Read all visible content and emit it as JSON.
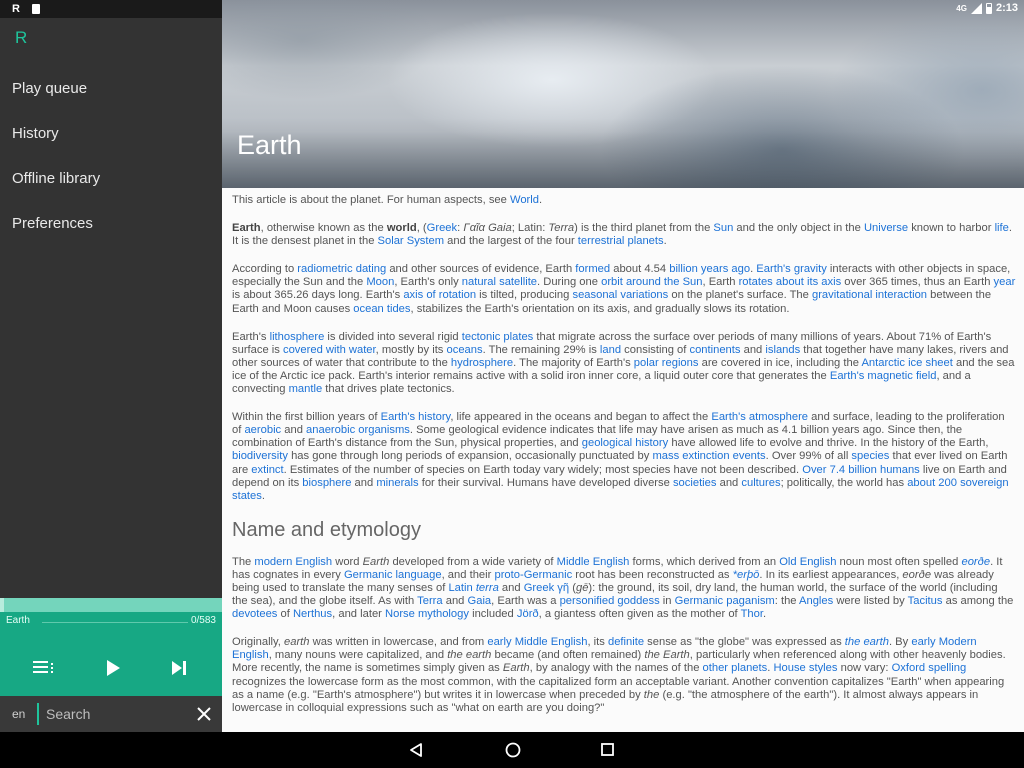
{
  "status_bar": {
    "left_letter": "R",
    "network": "4G",
    "time": "2:13"
  },
  "app": {
    "logo": "R"
  },
  "sidebar": {
    "items": [
      {
        "label": "Play queue"
      },
      {
        "label": "History"
      },
      {
        "label": "Offline library"
      },
      {
        "label": "Preferences"
      }
    ]
  },
  "player": {
    "track_title": "Earth",
    "track_count": "0/583",
    "progress_fraction": 0.02
  },
  "search": {
    "lang": "en",
    "placeholder": "Search",
    "value": ""
  },
  "article": {
    "title": "Earth",
    "hatnote": [
      "This article is about the planet. For human aspects, see ",
      {
        "a": "World"
      },
      "."
    ],
    "paragraphs_1": [
      [
        {
          "b": "Earth"
        },
        ", otherwise known as the ",
        {
          "b": "world"
        },
        ", (",
        {
          "a": "Greek"
        },
        ": ",
        {
          "i": "Γαῖα Gaia"
        },
        "; Latin: ",
        {
          "i": "Terra"
        },
        ") is the third planet from the ",
        {
          "a": "Sun"
        },
        " and the only object in the ",
        {
          "a": "Universe"
        },
        " known to harbor ",
        {
          "a": "life"
        },
        ". It is the densest planet in the ",
        {
          "a": "Solar System"
        },
        " and the largest of the four ",
        {
          "a": "terrestrial planets"
        },
        "."
      ],
      [
        "According to ",
        {
          "a": "radiometric dating"
        },
        " and other sources of evidence, Earth ",
        {
          "a": "formed"
        },
        " about 4.54 ",
        {
          "a": "billion years ago"
        },
        ". ",
        {
          "a": "Earth's gravity"
        },
        " interacts with other objects in space, especially the Sun and the ",
        {
          "a": "Moon"
        },
        ", Earth's only ",
        {
          "a": "natural satellite"
        },
        ". During one ",
        {
          "a": "orbit around the Sun"
        },
        ", Earth ",
        {
          "a": "rotates about its axis"
        },
        " over 365 times, thus an Earth ",
        {
          "a": "year"
        },
        " is about 365.26 days long. Earth's ",
        {
          "a": "axis of rotation"
        },
        " is tilted, producing ",
        {
          "a": "seasonal variations"
        },
        " on the planet's surface. The ",
        {
          "a": "gravitational interaction"
        },
        " between the Earth and Moon causes ",
        {
          "a": "ocean tides"
        },
        ", stabilizes the Earth's orientation on its axis, and gradually slows its rotation."
      ],
      [
        "Earth's ",
        {
          "a": "lithosphere"
        },
        " is divided into several rigid ",
        {
          "a": "tectonic plates"
        },
        " that migrate across the surface over periods of many millions of years. About 71% of Earth's surface is ",
        {
          "a": "covered with water"
        },
        ", mostly by its ",
        {
          "a": "oceans"
        },
        ". The remaining 29% is ",
        {
          "a": "land"
        },
        " consisting of ",
        {
          "a": "continents"
        },
        " and ",
        {
          "a": "islands"
        },
        " that together have many lakes, rivers and other sources of water that contribute to the ",
        {
          "a": "hydrosphere"
        },
        ". The majority of Earth's ",
        {
          "a": "polar regions"
        },
        " are covered in ice, including the ",
        {
          "a": "Antarctic ice sheet"
        },
        " and the sea ice of the Arctic ice pack. Earth's interior remains active with a solid iron inner core, a liquid outer core that generates the ",
        {
          "a": "Earth's magnetic field"
        },
        ", and a convecting ",
        {
          "a": "mantle"
        },
        " that drives plate tectonics."
      ],
      [
        "Within the first billion years of ",
        {
          "a": "Earth's history"
        },
        ", life appeared in the oceans and began to affect the ",
        {
          "a": "Earth's atmosphere"
        },
        " and surface, leading to the proliferation of ",
        {
          "a": "aerobic"
        },
        " and ",
        {
          "a": "anaerobic organisms"
        },
        ". Some geological evidence indicates that life may have arisen as much as 4.1 billion years ago. Since then, the combination of Earth's distance from the Sun, physical properties, and ",
        {
          "a": "geological history"
        },
        " have allowed life to evolve and thrive. In the history of the Earth, ",
        {
          "a": "biodiversity"
        },
        " has gone through long periods of expansion, occasionally punctuated by ",
        {
          "a": "mass extinction events"
        },
        ". Over 99% of all ",
        {
          "a": "species"
        },
        " that ever lived on Earth are ",
        {
          "a": "extinct"
        },
        ". Estimates of the number of species on Earth today vary widely; most species have not been described. ",
        {
          "a": "Over 7.4 billion humans"
        },
        " live on Earth and depend on its ",
        {
          "a": "biosphere"
        },
        " and ",
        {
          "a": "minerals"
        },
        " for their survival. Humans have developed diverse ",
        {
          "a": "societies"
        },
        " and ",
        {
          "a": "cultures"
        },
        "; politically, the world has ",
        {
          "a": "about 200 sovereign states"
        },
        "."
      ]
    ],
    "section_heading": "Name and etymology",
    "paragraphs_2": [
      [
        "The ",
        {
          "a": "modern English"
        },
        " word ",
        {
          "i": "Earth"
        },
        " developed from a wide variety of ",
        {
          "a": "Middle English"
        },
        " forms, which derived from an ",
        {
          "a": "Old English"
        },
        " noun most often spelled ",
        {
          "a": "eorðe",
          "i": true
        },
        ". It has cognates in every ",
        {
          "a": "Germanic language"
        },
        ", and their ",
        {
          "a": "proto-Germanic"
        },
        " root has been reconstructed as ",
        {
          "a": "*erþō",
          "i": true
        },
        ". In its earliest appearances, ",
        {
          "i": "eorðe"
        },
        " was already being used to translate the many senses of ",
        {
          "a": "Latin "
        },
        {
          "a": "terra",
          "i": true
        },
        " and ",
        {
          "a": "Greek"
        },
        " ",
        {
          "a": "γῆ"
        },
        " (",
        {
          "i": "gē"
        },
        "): the ground, its soil, dry land, the human world, the surface of the world (including the sea), and the globe itself. As with ",
        {
          "a": "Terra"
        },
        " and ",
        {
          "a": "Gaia"
        },
        ", Earth was a ",
        {
          "a": "personified goddess"
        },
        " in ",
        {
          "a": "Germanic paganism"
        },
        ": the ",
        {
          "a": "Angles"
        },
        " were listed by ",
        {
          "a": "Tacitus"
        },
        " as among the ",
        {
          "a": "devotees"
        },
        " of ",
        {
          "a": "Nerthus"
        },
        ", and later ",
        {
          "a": "Norse mythology"
        },
        " included ",
        {
          "a": "Jörð"
        },
        ", a giantess often given as the mother of ",
        {
          "a": "Thor"
        },
        "."
      ],
      [
        "Originally, ",
        {
          "i": "earth"
        },
        " was written in lowercase, and from ",
        {
          "a": "early Middle English"
        },
        ", its ",
        {
          "a": "definite"
        },
        " sense as \"the globe\" was expressed as ",
        {
          "a": "the earth",
          "i": true
        },
        ". By ",
        {
          "a": "early Modern English"
        },
        ", many nouns were capitalized, and ",
        {
          "i": "the earth"
        },
        " became (and often remained) ",
        {
          "i": "the Earth"
        },
        ", particularly when referenced along with other heavenly bodies. More recently, the name is sometimes simply given as ",
        {
          "i": "Earth"
        },
        ", by analogy with the names of the ",
        {
          "a": "other planets"
        },
        ". ",
        {
          "a": "House styles"
        },
        " now vary: ",
        {
          "a": "Oxford spelling"
        },
        " recognizes the lowercase form as the most common, with the capitalized form an acceptable variant. Another convention capitalizes \"Earth\" when appearing as a name (e.g. \"Earth's atmosphere\") but writes it in lowercase when preceded by ",
        {
          "i": "the"
        },
        " (e.g. \"the atmosphere of the earth\"). It almost always appears in lowercase in colloquial expressions such as \"what on earth are you doing?\""
      ]
    ]
  },
  "icons": {
    "sd_card": "sd-card-icon",
    "battery": "battery-icon",
    "queue": "queue-icon",
    "play": "play-icon",
    "next": "skip-next-icon",
    "close": "close-icon",
    "back": "back-icon",
    "home": "home-icon",
    "recents": "recents-icon"
  },
  "colors": {
    "accent": "#1fc49c",
    "player": "#17a884",
    "sidebar": "#333333",
    "link": "#1d72d6"
  }
}
